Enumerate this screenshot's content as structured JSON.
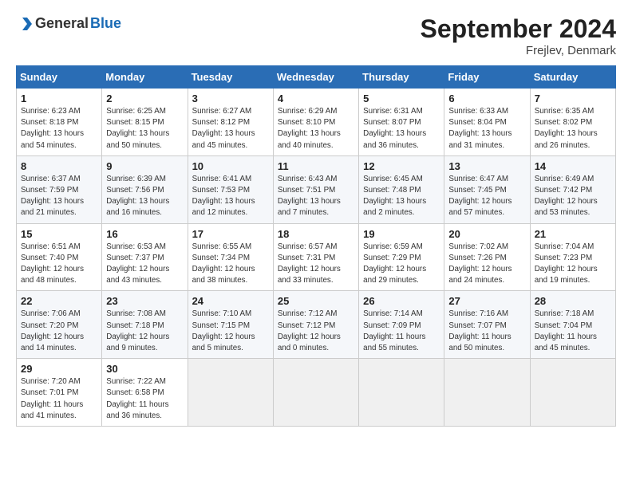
{
  "header": {
    "logo_general": "General",
    "logo_blue": "Blue",
    "title": "September 2024",
    "location": "Frejlev, Denmark"
  },
  "weekdays": [
    "Sunday",
    "Monday",
    "Tuesday",
    "Wednesday",
    "Thursday",
    "Friday",
    "Saturday"
  ],
  "weeks": [
    [
      {
        "day": "1",
        "sunrise": "6:23 AM",
        "sunset": "8:18 PM",
        "daylight": "13 hours and 54 minutes."
      },
      {
        "day": "2",
        "sunrise": "6:25 AM",
        "sunset": "8:15 PM",
        "daylight": "13 hours and 50 minutes."
      },
      {
        "day": "3",
        "sunrise": "6:27 AM",
        "sunset": "8:12 PM",
        "daylight": "13 hours and 45 minutes."
      },
      {
        "day": "4",
        "sunrise": "6:29 AM",
        "sunset": "8:10 PM",
        "daylight": "13 hours and 40 minutes."
      },
      {
        "day": "5",
        "sunrise": "6:31 AM",
        "sunset": "8:07 PM",
        "daylight": "13 hours and 36 minutes."
      },
      {
        "day": "6",
        "sunrise": "6:33 AM",
        "sunset": "8:04 PM",
        "daylight": "13 hours and 31 minutes."
      },
      {
        "day": "7",
        "sunrise": "6:35 AM",
        "sunset": "8:02 PM",
        "daylight": "13 hours and 26 minutes."
      }
    ],
    [
      {
        "day": "8",
        "sunrise": "6:37 AM",
        "sunset": "7:59 PM",
        "daylight": "13 hours and 21 minutes."
      },
      {
        "day": "9",
        "sunrise": "6:39 AM",
        "sunset": "7:56 PM",
        "daylight": "13 hours and 16 minutes."
      },
      {
        "day": "10",
        "sunrise": "6:41 AM",
        "sunset": "7:53 PM",
        "daylight": "13 hours and 12 minutes."
      },
      {
        "day": "11",
        "sunrise": "6:43 AM",
        "sunset": "7:51 PM",
        "daylight": "13 hours and 7 minutes."
      },
      {
        "day": "12",
        "sunrise": "6:45 AM",
        "sunset": "7:48 PM",
        "daylight": "13 hours and 2 minutes."
      },
      {
        "day": "13",
        "sunrise": "6:47 AM",
        "sunset": "7:45 PM",
        "daylight": "12 hours and 57 minutes."
      },
      {
        "day": "14",
        "sunrise": "6:49 AM",
        "sunset": "7:42 PM",
        "daylight": "12 hours and 53 minutes."
      }
    ],
    [
      {
        "day": "15",
        "sunrise": "6:51 AM",
        "sunset": "7:40 PM",
        "daylight": "12 hours and 48 minutes."
      },
      {
        "day": "16",
        "sunrise": "6:53 AM",
        "sunset": "7:37 PM",
        "daylight": "12 hours and 43 minutes."
      },
      {
        "day": "17",
        "sunrise": "6:55 AM",
        "sunset": "7:34 PM",
        "daylight": "12 hours and 38 minutes."
      },
      {
        "day": "18",
        "sunrise": "6:57 AM",
        "sunset": "7:31 PM",
        "daylight": "12 hours and 33 minutes."
      },
      {
        "day": "19",
        "sunrise": "6:59 AM",
        "sunset": "7:29 PM",
        "daylight": "12 hours and 29 minutes."
      },
      {
        "day": "20",
        "sunrise": "7:02 AM",
        "sunset": "7:26 PM",
        "daylight": "12 hours and 24 minutes."
      },
      {
        "day": "21",
        "sunrise": "7:04 AM",
        "sunset": "7:23 PM",
        "daylight": "12 hours and 19 minutes."
      }
    ],
    [
      {
        "day": "22",
        "sunrise": "7:06 AM",
        "sunset": "7:20 PM",
        "daylight": "12 hours and 14 minutes."
      },
      {
        "day": "23",
        "sunrise": "7:08 AM",
        "sunset": "7:18 PM",
        "daylight": "12 hours and 9 minutes."
      },
      {
        "day": "24",
        "sunrise": "7:10 AM",
        "sunset": "7:15 PM",
        "daylight": "12 hours and 5 minutes."
      },
      {
        "day": "25",
        "sunrise": "7:12 AM",
        "sunset": "7:12 PM",
        "daylight": "12 hours and 0 minutes."
      },
      {
        "day": "26",
        "sunrise": "7:14 AM",
        "sunset": "7:09 PM",
        "daylight": "11 hours and 55 minutes."
      },
      {
        "day": "27",
        "sunrise": "7:16 AM",
        "sunset": "7:07 PM",
        "daylight": "11 hours and 50 minutes."
      },
      {
        "day": "28",
        "sunrise": "7:18 AM",
        "sunset": "7:04 PM",
        "daylight": "11 hours and 45 minutes."
      }
    ],
    [
      {
        "day": "29",
        "sunrise": "7:20 AM",
        "sunset": "7:01 PM",
        "daylight": "11 hours and 41 minutes."
      },
      {
        "day": "30",
        "sunrise": "7:22 AM",
        "sunset": "6:58 PM",
        "daylight": "11 hours and 36 minutes."
      },
      null,
      null,
      null,
      null,
      null
    ]
  ]
}
